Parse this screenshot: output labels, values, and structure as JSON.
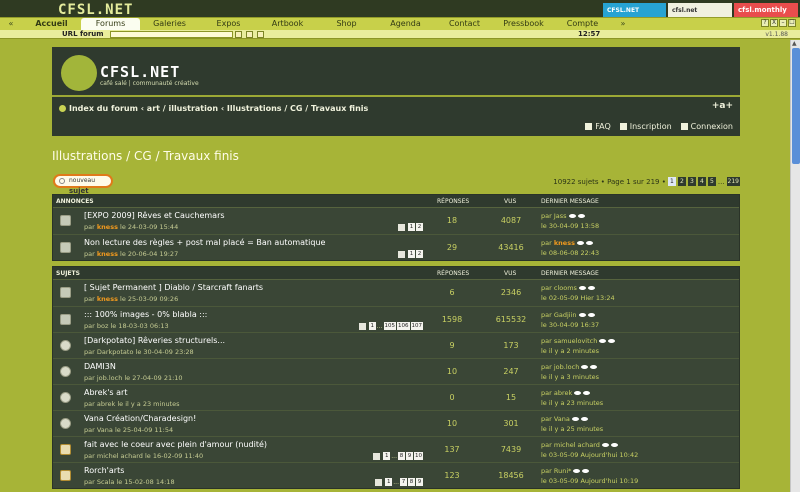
{
  "topbar": {
    "logo": "CFSL.NET",
    "banners": [
      "CFSL.NET",
      "cfsl.net",
      "cfsl.monthly"
    ],
    "tabs": [
      "Accueil",
      "Forums",
      "Galeries",
      "Expos",
      "Artbook",
      "Shop",
      "Agenda",
      "Contact",
      "Pressbook",
      "Compte"
    ],
    "active_tab": "Forums",
    "win_controls": [
      "?",
      "X",
      "–",
      "☐"
    ]
  },
  "urlbar": {
    "label": "URL forum",
    "clock": "12:57",
    "version": "v1.1.88"
  },
  "header": {
    "logo_text": "CFSL.NET",
    "tagline": "café salé | communauté créative",
    "breadcrumb": "Index du forum ‹ art / illustration ‹ Illustrations / CG / Travaux finis",
    "fontsize_label": "+a+",
    "user_links": [
      {
        "label": "FAQ"
      },
      {
        "label": "Inscription"
      },
      {
        "label": "Connexion"
      }
    ]
  },
  "page_title": "Illustrations / CG / Travaux finis",
  "new_topic": {
    "prefix": "nouveau",
    "label": "sujet"
  },
  "pagination": {
    "summary": "10922 sujets • Page 1 sur 219 •",
    "pages": [
      "1",
      "2",
      "3",
      "4",
      "5"
    ],
    "ellipsis": "...",
    "last": "219"
  },
  "announcements": {
    "title": "ANNONCES",
    "col_replies": "RÉPONSES",
    "col_views": "VUS",
    "col_last": "DERNIER MESSAGE",
    "rows": [
      {
        "title": "[EXPO 2009] Rêves et Cauchemars",
        "by": "par",
        "author": "kness",
        "author_mod": true,
        "date": "le 24-03-09 15:44",
        "pages": [
          "1",
          "2"
        ],
        "replies": "18",
        "views": "4087",
        "last_by": "Jass",
        "last_mod": false,
        "last_date": "le 30-04-09 13:58"
      },
      {
        "title": "Non lecture des règles + post mal placé = Ban automatique",
        "by": "par",
        "author": "kness",
        "author_mod": true,
        "date": "le 20-06-04 19:27",
        "pages": [
          "1",
          "2"
        ],
        "replies": "29",
        "views": "43416",
        "last_by": "kness",
        "last_mod": true,
        "last_date": "le 08-06-08 22:43"
      }
    ]
  },
  "topics": {
    "title": "SUJETS",
    "col_replies": "RÉPONSES",
    "col_views": "VUS",
    "col_last": "DERNIER MESSAGE",
    "rows": [
      {
        "title": "[ Sujet Permanent ] Diablo / Starcraft fanarts",
        "by": "par",
        "author": "kness",
        "author_mod": true,
        "date": "le 25-03-09 09:26",
        "pages": [],
        "replies": "6",
        "views": "2346",
        "last_by": "clooms",
        "last_mod": false,
        "last_date": "le 02-05-09 Hier 13:24"
      },
      {
        "title": "::: 100% images - 0% blabla :::",
        "by": "par",
        "author": "boz",
        "author_mod": false,
        "date": "le 18-03-03 06:13",
        "pages": [
          "1",
          "...",
          "105",
          "106",
          "107"
        ],
        "replies": "1598",
        "views": "615532",
        "last_by": "Gadjiin",
        "last_mod": false,
        "last_date": "le 30-04-09 16:37"
      },
      {
        "title": "[Darkpotato] Rêveries structurels...",
        "by": "par",
        "author": "Darkpotato",
        "author_mod": false,
        "date": "le 30-04-09 23:28",
        "pages": [],
        "replies": "9",
        "views": "173",
        "last_by": "samuelovitch",
        "last_mod": false,
        "last_date": "le il y a 2 minutes"
      },
      {
        "title": "DAMI3N",
        "by": "par",
        "author": "job.loch",
        "author_mod": false,
        "date": "le 27-04-09 21:10",
        "pages": [],
        "replies": "10",
        "views": "247",
        "last_by": "job.loch",
        "last_mod": false,
        "last_date": "le il y a 3 minutes"
      },
      {
        "title": "Abrek's art",
        "by": "par",
        "author": "abrek",
        "author_mod": false,
        "date": "le il y a 23 minutes",
        "pages": [],
        "replies": "0",
        "views": "15",
        "last_by": "abrek",
        "last_mod": false,
        "last_date": "le il y a 23 minutes"
      },
      {
        "title": "Vana Création/Charadesign!",
        "by": "par",
        "author": "Vana",
        "author_mod": false,
        "date": "le 25-04-09 11:54",
        "pages": [],
        "replies": "10",
        "views": "301",
        "last_by": "Vana",
        "last_mod": false,
        "last_date": "le il y a 25 minutes"
      },
      {
        "title": "fait avec le coeur avec plein d'amour (nudité)",
        "by": "par",
        "author": "michel achard",
        "author_mod": false,
        "date": "le 16-02-09 11:40",
        "pages": [
          "1",
          "...",
          "8",
          "9",
          "10"
        ],
        "replies": "137",
        "views": "7439",
        "last_by": "michel achard",
        "last_mod": false,
        "last_date": "le 03-05-09 Aujourd'hui 10:42"
      },
      {
        "title": "Rorch'arts",
        "by": "par",
        "author": "Scala",
        "author_mod": false,
        "date": "le 15-02-08 14:18",
        "pages": [
          "1",
          "...",
          "7",
          "8",
          "9"
        ],
        "replies": "123",
        "views": "18456",
        "last_by": "Runi*",
        "last_mod": false,
        "last_date": "le 03-05-09 Aujourd'hui 10:19"
      }
    ]
  }
}
